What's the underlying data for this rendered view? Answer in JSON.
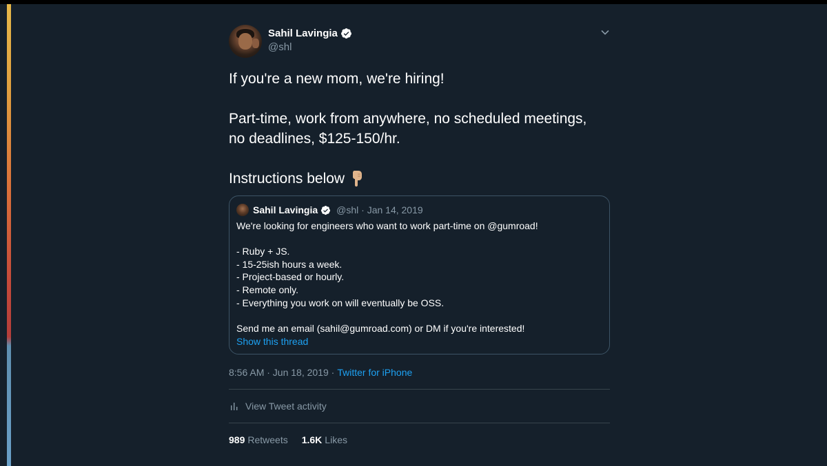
{
  "author": {
    "name": "Sahil Lavingia",
    "handle": "@shl"
  },
  "tweet": {
    "line1": "If you're a new mom, we're hiring!",
    "line2": "Part-time, work from anywhere, no scheduled meetings,",
    "line3": "no deadlines, $125-150/hr.",
    "line4": "Instructions below",
    "emoji": "point-down-emoji"
  },
  "quoted": {
    "name": "Sahil Lavingia",
    "meta": "@shl · Jan 14, 2019",
    "intro": "We're looking for engineers who want to work part-time on @gumroad!",
    "bullets": [
      "- Ruby + JS.",
      "- 15-25ish hours a week.",
      "- Project-based or hourly.",
      "- Remote only.",
      "- Everything you work on will eventually be OSS."
    ],
    "closing": "Send me an email (sahil@gumroad.com) or DM if you're interested!",
    "thread_link": "Show this thread"
  },
  "meta": {
    "time": "8:56 AM · Jun 18, 2019 ·",
    "source": "Twitter for iPhone"
  },
  "activity": {
    "label": "View Tweet activity",
    "icon": "bar-chart-icon"
  },
  "stats": {
    "retweets_count": "989",
    "retweets_label": "Retweets",
    "likes_count": "1.6K",
    "likes_label": "Likes"
  },
  "colors": {
    "background": "#15202b",
    "link": "#1da1f2",
    "muted": "#8899a6",
    "border": "#3d5466"
  }
}
